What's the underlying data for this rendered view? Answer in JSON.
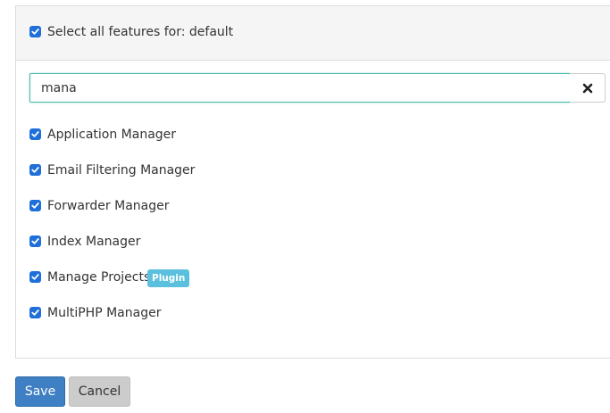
{
  "select_all": {
    "label": "Select all features for: default",
    "checked": true
  },
  "search": {
    "value": "mana",
    "clear_icon": "close-icon"
  },
  "features": [
    {
      "label": "Application Manager",
      "checked": true
    },
    {
      "label": "Email Filtering Manager",
      "checked": true
    },
    {
      "label": "Forwarder Manager",
      "checked": true
    },
    {
      "label": "Index Manager",
      "checked": true
    },
    {
      "label": "Manage Projects",
      "checked": true,
      "badge": "Plugin"
    },
    {
      "label": "MultiPHP Manager",
      "checked": true
    }
  ],
  "actions": {
    "save_label": "Save",
    "cancel_label": "Cancel"
  },
  "colors": {
    "checkbox": "#1e6fd9",
    "search_focus_border": "#48b7a9",
    "badge": "#5bc0de",
    "save_button": "#3f7fc4",
    "cancel_button": "#cccccc"
  }
}
